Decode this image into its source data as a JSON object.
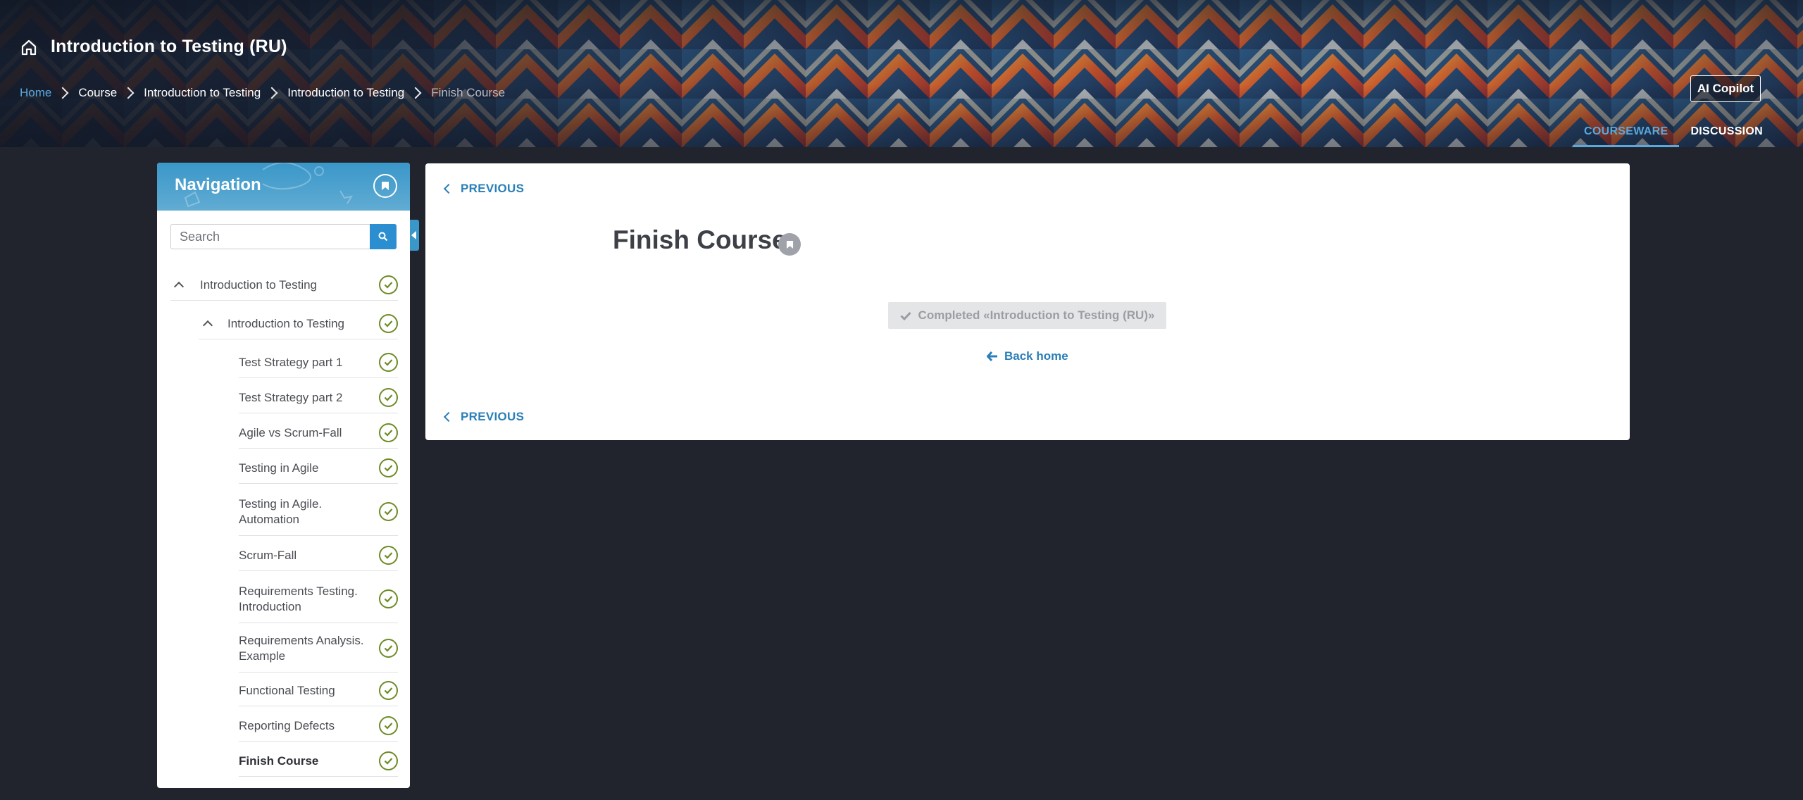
{
  "header": {
    "course_title": "Introduction to Testing (RU)",
    "breadcrumb": [
      "Home",
      "Course",
      "Introduction to Testing",
      "Introduction to Testing",
      "Finish Course"
    ],
    "copilot_label": "AI Copilot",
    "tabs": [
      "COURSEWARE",
      "DISCUSSION"
    ],
    "active_tab": "COURSEWARE"
  },
  "sidebar": {
    "title": "Navigation",
    "search_placeholder": "Search",
    "section": "Introduction to Testing",
    "subsection": "Introduction to Testing",
    "units": [
      "Test Strategy part 1",
      "Test Strategy part 2",
      "Agile vs Scrum-Fall",
      "Testing in Agile",
      "Testing in Agile. Automation",
      "Scrum-Fall",
      "Requirements Testing. Introduction",
      "Requirements Analysis. Example",
      "Functional Testing",
      "Reporting Defects",
      "Finish Course"
    ],
    "current_unit": "Finish Course",
    "all_completed": true
  },
  "main": {
    "previous_label": "PREVIOUS",
    "unit_title": "Finish Course",
    "completed_label": "Completed «Introduction to Testing (RU)»",
    "back_home_label": "Back home"
  },
  "colors": {
    "page_bg": "#21242d",
    "accent": "#2a7fb8",
    "link": "#5aa8dc",
    "complete_green": "#6c8b24"
  },
  "icons": [
    "home-icon",
    "chevron-right-icon",
    "bookmark-icon",
    "search-icon",
    "chevron-up-icon",
    "check-circle-icon",
    "chevron-left-icon",
    "check-icon",
    "arrow-left-icon"
  ]
}
